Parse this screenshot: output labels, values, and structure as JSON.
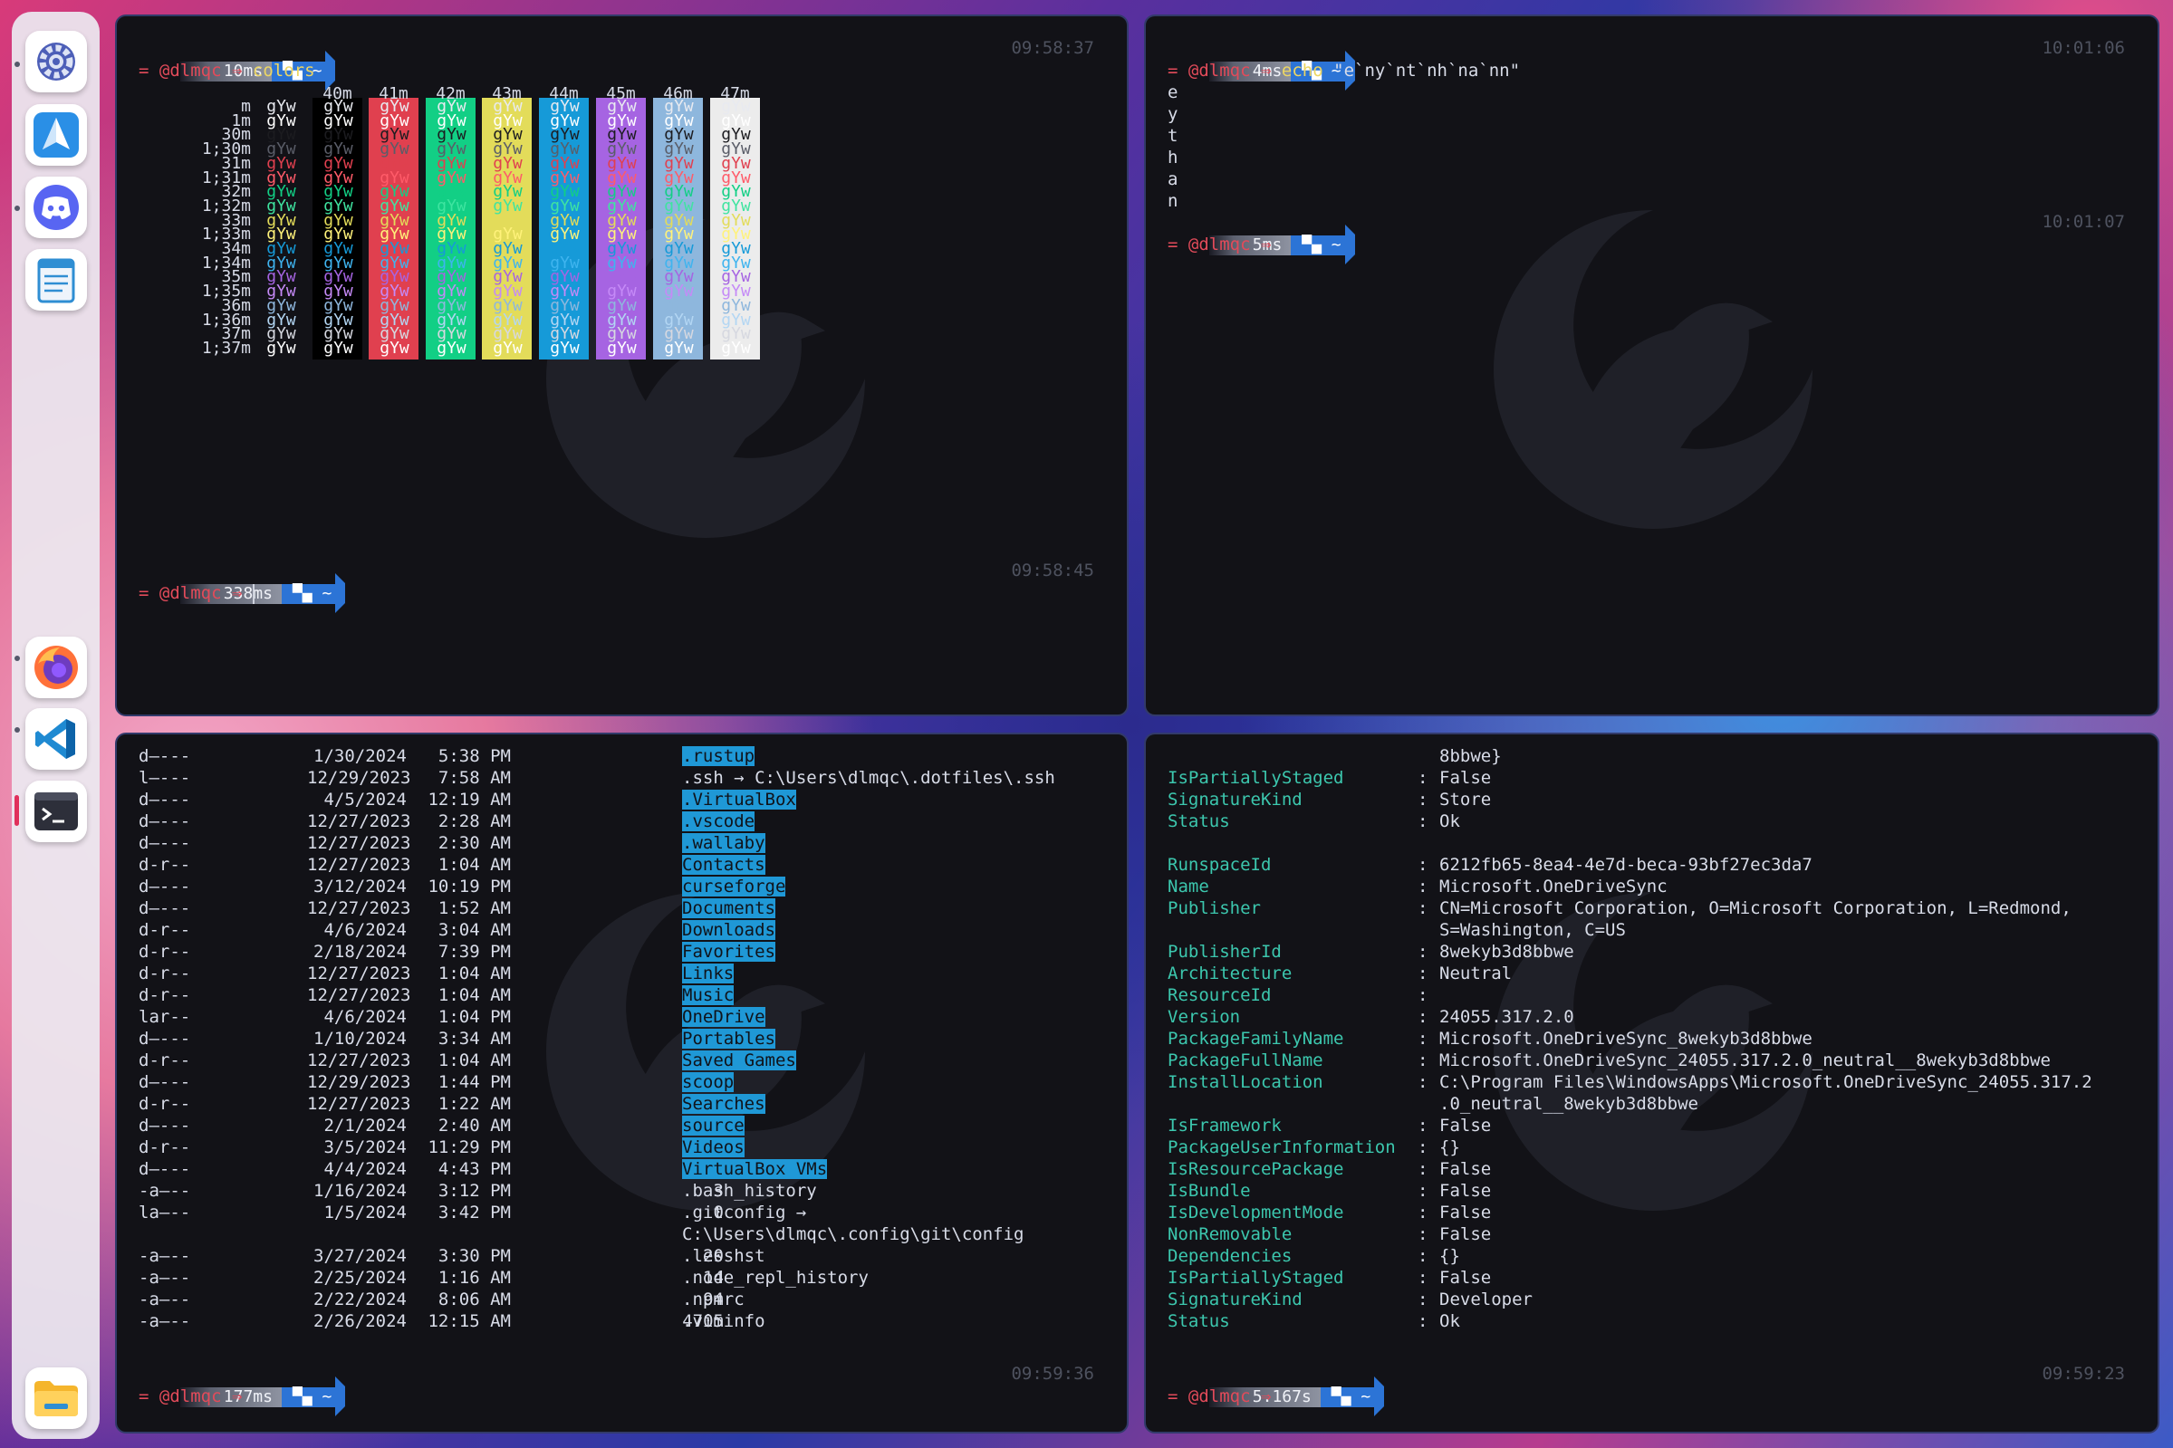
{
  "dock": {
    "items": [
      {
        "name": "settings-app",
        "icon": "gear-icon"
      },
      {
        "name": "paper-plane-app",
        "icon": "paper-plane-icon"
      },
      {
        "name": "discord-app",
        "icon": "discord-icon"
      },
      {
        "name": "notes-app",
        "icon": "notepad-icon"
      },
      {
        "name": "firefox-app",
        "icon": "firefox-icon"
      },
      {
        "name": "vscode-app",
        "icon": "vscode-icon"
      },
      {
        "name": "terminal-app",
        "icon": "terminal-icon"
      },
      {
        "name": "files-app",
        "icon": "folder-icon"
      }
    ]
  },
  "colors": {
    "bg": "#121217",
    "accent": "#2c74d6",
    "prompt": "#e24b5a",
    "command": "#ecd663",
    "key": "#3cc7ae",
    "highlight": "#1f98d6"
  },
  "p1": {
    "top": {
      "time": "10ms",
      "dir": "~",
      "clock": "09:58:37",
      "sym": "=",
      "user": "@dlmqc",
      "arrow": "⇒",
      "cmd": "colors"
    },
    "bottom": {
      "time": "338ms",
      "dir": "~",
      "clock": "09:58:45",
      "sym": "=",
      "user": "@dlmqc",
      "arrow": "⇒"
    },
    "headers": [
      "40m",
      "41m",
      "42m",
      "43m",
      "44m",
      "45m",
      "46m",
      "47m"
    ],
    "rows": [
      "m",
      "1m",
      "30m",
      "1;30m",
      "31m",
      "1;31m",
      "32m",
      "1;32m",
      "33m",
      "1;33m",
      "34m",
      "1;34m",
      "35m",
      "1;35m",
      "36m",
      "1;36m",
      "37m",
      "1;37m"
    ],
    "sample": "gYw"
  },
  "p2": {
    "cmd1": {
      "time": "4ms",
      "dir": "~",
      "clock": "10:01:06",
      "sym": "=",
      "user": "@dlmqc",
      "arrow": "⇒",
      "cmd": "echo",
      "arg": "\"e`ny`nt`nh`na`nn\""
    },
    "output": [
      "e",
      "y",
      "t",
      "h",
      "a",
      "n"
    ],
    "cmd2": {
      "time": "5ms",
      "dir": "~",
      "clock": "10:01:07",
      "sym": "=",
      "user": "@dlmqc",
      "arrow": "⇒"
    }
  },
  "p3": {
    "rows": [
      {
        "mode": "d—---",
        "date": "1/30/2024",
        "time": "5:38 PM",
        "size": "",
        "name": ".rustup",
        "hl": true,
        "target": ""
      },
      {
        "mode": "l—---",
        "date": "12/29/2023",
        "time": "7:58 AM",
        "size": "",
        "name": ".ssh",
        "hl": false,
        "target": " → C:\\Users\\dlmqc\\.dotfiles\\.ssh"
      },
      {
        "mode": "d—---",
        "date": "4/5/2024",
        "time": "12:19 AM",
        "size": "",
        "name": ".VirtualBox",
        "hl": true,
        "target": ""
      },
      {
        "mode": "d—---",
        "date": "12/27/2023",
        "time": "2:28 AM",
        "size": "",
        "name": ".vscode",
        "hl": true,
        "target": ""
      },
      {
        "mode": "d—---",
        "date": "12/27/2023",
        "time": "2:30 AM",
        "size": "",
        "name": ".wallaby",
        "hl": true,
        "target": ""
      },
      {
        "mode": "d-r--",
        "date": "12/27/2023",
        "time": "1:04 AM",
        "size": "",
        "name": "Contacts",
        "hl": true,
        "target": ""
      },
      {
        "mode": "d—---",
        "date": "3/12/2024",
        "time": "10:19 PM",
        "size": "",
        "name": "curseforge",
        "hl": true,
        "target": ""
      },
      {
        "mode": "d—---",
        "date": "12/27/2023",
        "time": "1:52 AM",
        "size": "",
        "name": "Documents",
        "hl": true,
        "target": ""
      },
      {
        "mode": "d-r--",
        "date": "4/6/2024",
        "time": "3:04 AM",
        "size": "",
        "name": "Downloads",
        "hl": true,
        "target": ""
      },
      {
        "mode": "d-r--",
        "date": "2/18/2024",
        "time": "7:39 PM",
        "size": "",
        "name": "Favorites",
        "hl": true,
        "target": ""
      },
      {
        "mode": "d-r--",
        "date": "12/27/2023",
        "time": "1:04 AM",
        "size": "",
        "name": "Links",
        "hl": true,
        "target": ""
      },
      {
        "mode": "d-r--",
        "date": "12/27/2023",
        "time": "1:04 AM",
        "size": "",
        "name": "Music",
        "hl": true,
        "target": ""
      },
      {
        "mode": "lar--",
        "date": "4/6/2024",
        "time": "1:04 PM",
        "size": "",
        "name": "OneDrive",
        "hl": true,
        "target": ""
      },
      {
        "mode": "d—---",
        "date": "1/10/2024",
        "time": "3:34 AM",
        "size": "",
        "name": "Portables",
        "hl": true,
        "target": ""
      },
      {
        "mode": "d-r--",
        "date": "12/27/2023",
        "time": "1:04 AM",
        "size": "",
        "name": "Saved Games",
        "hl": true,
        "target": ""
      },
      {
        "mode": "d—---",
        "date": "12/29/2023",
        "time": "1:44 PM",
        "size": "",
        "name": "scoop",
        "hl": true,
        "target": ""
      },
      {
        "mode": "d-r--",
        "date": "12/27/2023",
        "time": "1:22 AM",
        "size": "",
        "name": "Searches",
        "hl": true,
        "target": ""
      },
      {
        "mode": "d—---",
        "date": "2/1/2024",
        "time": "2:40 AM",
        "size": "",
        "name": "source",
        "hl": true,
        "target": ""
      },
      {
        "mode": "d-r--",
        "date": "3/5/2024",
        "time": "11:29 PM",
        "size": "",
        "name": "Videos",
        "hl": true,
        "target": ""
      },
      {
        "mode": "d—---",
        "date": "4/4/2024",
        "time": "4:43 PM",
        "size": "",
        "name": "VirtualBox VMs",
        "hl": true,
        "target": ""
      },
      {
        "mode": "-a—--",
        "date": "1/16/2024",
        "time": "3:12 PM",
        "size": "3",
        "name": ".bash_history",
        "hl": false,
        "target": ""
      },
      {
        "mode": "la—--",
        "date": "1/5/2024",
        "time": "3:42 PM",
        "size": "0",
        "name": ".gitconfig",
        "hl": false,
        "target": " →"
      },
      {
        "mode": "",
        "date": "",
        "time": "",
        "size": "",
        "name": "C:\\Users\\dlmqc\\.config\\git\\config",
        "hl": false,
        "target": ""
      },
      {
        "mode": "-a—--",
        "date": "3/27/2024",
        "time": "3:30 PM",
        "size": "20",
        "name": ".lesshst",
        "hl": false,
        "target": ""
      },
      {
        "mode": "-a—--",
        "date": "2/25/2024",
        "time": "1:16 AM",
        "size": "14",
        "name": ".node_repl_history",
        "hl": false,
        "target": ""
      },
      {
        "mode": "-a—--",
        "date": "2/22/2024",
        "time": "8:06 AM",
        "size": "94",
        "name": ".npmrc",
        "hl": false,
        "target": ""
      },
      {
        "mode": "-a—--",
        "date": "2/26/2024",
        "time": "12:15 AM",
        "size": "4705",
        "name": ".viminfo",
        "hl": false,
        "target": ""
      }
    ],
    "prompt": {
      "time": "177ms",
      "dir": "~",
      "clock": "09:59:36",
      "sym": "=",
      "user": "@dlmqc",
      "arrow": "⇒"
    }
  },
  "p4": {
    "rows": [
      {
        "k": "",
        "v": "8bbwe}"
      },
      {
        "k": "IsPartiallyStaged",
        "v": "False"
      },
      {
        "k": "SignatureKind",
        "v": "Store"
      },
      {
        "k": "Status",
        "v": "Ok"
      },
      {
        "k": "",
        "v": ""
      },
      {
        "k": "RunspaceId",
        "v": "6212fb65-8ea4-4e7d-beca-93bf27ec3da7"
      },
      {
        "k": "Name",
        "v": "Microsoft.OneDriveSync"
      },
      {
        "k": "Publisher",
        "v": "CN=Microsoft Corporation, O=Microsoft Corporation, L=Redmond,"
      },
      {
        "k": "",
        "v": "S=Washington, C=US"
      },
      {
        "k": "PublisherId",
        "v": "8wekyb3d8bbwe"
      },
      {
        "k": "Architecture",
        "v": "Neutral"
      },
      {
        "k": "ResourceId",
        "v": ""
      },
      {
        "k": "Version",
        "v": "24055.317.2.0"
      },
      {
        "k": "PackageFamilyName",
        "v": "Microsoft.OneDriveSync_8wekyb3d8bbwe"
      },
      {
        "k": "PackageFullName",
        "v": "Microsoft.OneDriveSync_24055.317.2.0_neutral__8wekyb3d8bbwe"
      },
      {
        "k": "InstallLocation",
        "v": "C:\\Program Files\\WindowsApps\\Microsoft.OneDriveSync_24055.317.2"
      },
      {
        "k": "",
        "v": ".0_neutral__8wekyb3d8bbwe"
      },
      {
        "k": "IsFramework",
        "v": "False"
      },
      {
        "k": "PackageUserInformation",
        "v": "{}"
      },
      {
        "k": "IsResourcePackage",
        "v": "False"
      },
      {
        "k": "IsBundle",
        "v": "False"
      },
      {
        "k": "IsDevelopmentMode",
        "v": "False"
      },
      {
        "k": "NonRemovable",
        "v": "False"
      },
      {
        "k": "Dependencies",
        "v": "{}"
      },
      {
        "k": "IsPartiallyStaged",
        "v": "False"
      },
      {
        "k": "SignatureKind",
        "v": "Developer"
      },
      {
        "k": "Status",
        "v": "Ok"
      }
    ],
    "prompt": {
      "time": "5.167s",
      "dir": "~",
      "clock": "09:59:23",
      "sym": "=",
      "user": "@dlmqc",
      "arrow": "⇒"
    }
  }
}
